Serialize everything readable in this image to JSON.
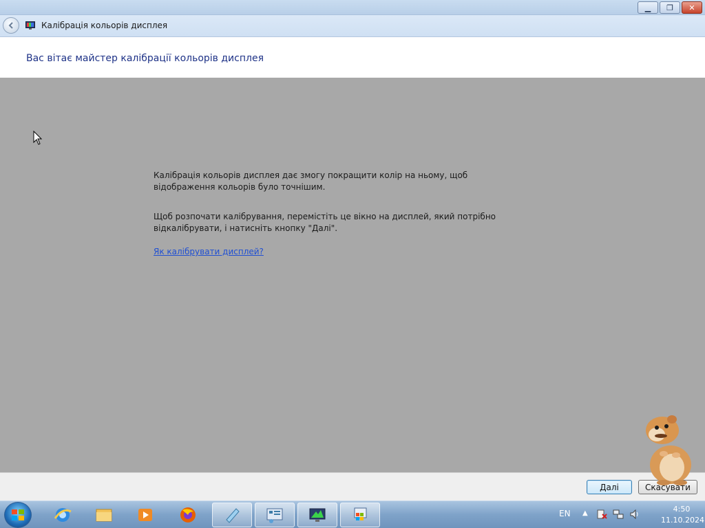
{
  "window": {
    "title": "Калібрація кольорів дисплея",
    "controls": {
      "minimize": "minimize-icon",
      "maximize": "maximize-icon",
      "close": "close-icon"
    }
  },
  "wizard": {
    "title": "Вас вітає майстер калібрації кольорів дисплея",
    "paragraph1": "Калібрація кольорів дисплея дає змогу покращити колір на ньому, щоб відображення кольорів було точнішим.",
    "paragraph2": "Щоб розпочати калібрування, перемістіть це вікно на дисплей, який потрібно відкалібрувати, і натисніть кнопку \"Далі\".",
    "help_link": "Як калібрувати дисплей?"
  },
  "footer": {
    "next_label": "Далі",
    "cancel_label": "Скасувати"
  },
  "taskbar": {
    "items": [
      "internet-explorer-icon",
      "file-explorer-icon",
      "media-player-icon",
      "firefox-icon",
      "notepad-icon",
      "control-panel-icon",
      "display-icon",
      "windows-update-icon"
    ],
    "tray": {
      "language": "EN",
      "time": "4:50",
      "date": "11.10.2024"
    }
  },
  "colors": {
    "title_blue": "#1e3287",
    "link_blue": "#1f4fd3",
    "content_gray": "#a8a8a8"
  }
}
